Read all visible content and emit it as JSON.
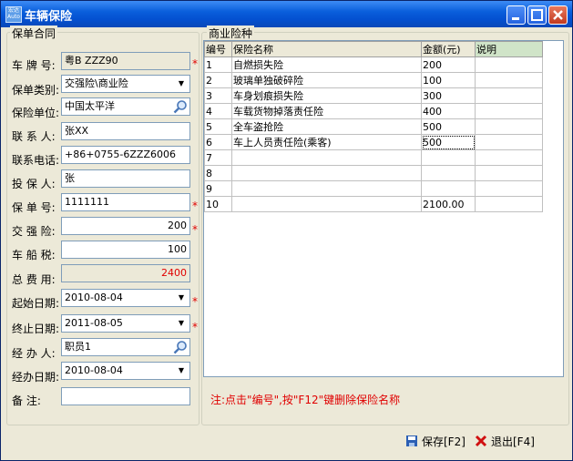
{
  "window": {
    "title": "车辆保险",
    "icon_text": "宏达 Auto",
    "icons": {
      "minimize": "minimize-icon",
      "maximize": "maximize-icon",
      "close": "close-icon"
    }
  },
  "contract": {
    "group_label": "保单合同",
    "plate": {
      "label": "车 牌 号:",
      "value": "粤B ZZZ90"
    },
    "insurance_type": {
      "label": "保单类别:",
      "value": "交强险\\商业险"
    },
    "insurer": {
      "label": "保险单位:",
      "value": "中国太平洋"
    },
    "contact": {
      "label": "联 系 人:",
      "value": "张XX"
    },
    "phone": {
      "label": "联系电话:",
      "value": "+86+0755-6ZZZ6006"
    },
    "insured": {
      "label": "投 保 人:",
      "value": "张"
    },
    "policy_no": {
      "label": "保 单 号:",
      "value": "1111111"
    },
    "compulsory": {
      "label": "交 强 险:",
      "value": "200"
    },
    "vessel_tax": {
      "label": "车 船 税:",
      "value": "100"
    },
    "total": {
      "label": "总 费 用:",
      "value": "2400"
    },
    "start_date": {
      "label": "起始日期:",
      "value": "2010-08-04"
    },
    "end_date": {
      "label": "终止日期:",
      "value": "2011-08-05"
    },
    "handler": {
      "label": "经 办 人:",
      "value": "职员1"
    },
    "handle_date": {
      "label": "经办日期:",
      "value": "2010-08-04"
    },
    "remark": {
      "label": "备    注:",
      "value": ""
    },
    "required_mark": "*"
  },
  "commercial": {
    "group_label": "商业险种",
    "columns": [
      "编号",
      "保险名称",
      "金额(元)",
      "说明"
    ],
    "rows": [
      [
        "1",
        "自燃损失险",
        "200",
        ""
      ],
      [
        "2",
        "玻璃单独破碎险",
        "100",
        ""
      ],
      [
        "3",
        "车身划痕损失险",
        "300",
        ""
      ],
      [
        "4",
        "车载货物掉落责任险",
        "400",
        ""
      ],
      [
        "5",
        "全车盗抢险",
        "500",
        ""
      ],
      [
        "6",
        "车上人员责任险(乘客)",
        "500",
        ""
      ],
      [
        "7",
        "",
        "",
        ""
      ],
      [
        "8",
        "",
        "",
        ""
      ],
      [
        "9",
        "",
        "",
        ""
      ],
      [
        "10",
        "",
        "2100.00",
        ""
      ]
    ],
    "note": "注:点击\"编号\",按\"F12\"键删除保险名称"
  },
  "actions": {
    "save": "保存[F2]",
    "exit": "退出[F4]"
  },
  "colors": {
    "title_bar": "#0a5fdc",
    "required": "#e00000",
    "window_bg": "#ece9d8"
  }
}
